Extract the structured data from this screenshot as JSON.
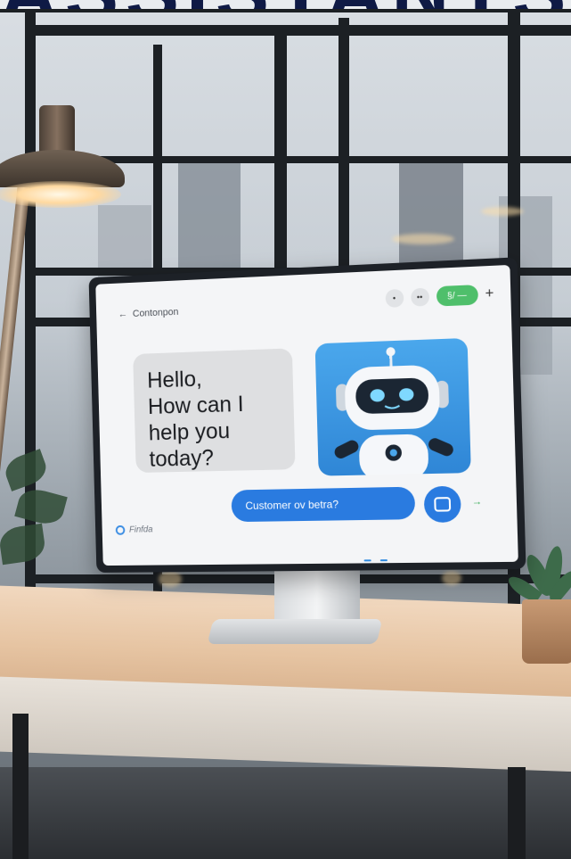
{
  "banner": {
    "text": "ASSISTANTS"
  },
  "screen": {
    "header_title": "Contonpon",
    "back_glyph": "←",
    "header_buttons": [
      "•",
      "••"
    ],
    "pill_label": "§/ —",
    "plus_glyph": "+",
    "greeting": "Hello,\nHow can I\nhelp you\ntoday?",
    "input_text": "Customer ov betra?",
    "side_arrow": "→",
    "brand": "Finfda"
  },
  "colors": {
    "accent_blue": "#2a7be0",
    "green_pill": "#4fbf6b",
    "bubble_gray": "#dedfe1"
  },
  "icons": [
    "back-arrow-icon",
    "send-icon",
    "plus-icon",
    "robot-avatar-icon",
    "brand-icon"
  ]
}
